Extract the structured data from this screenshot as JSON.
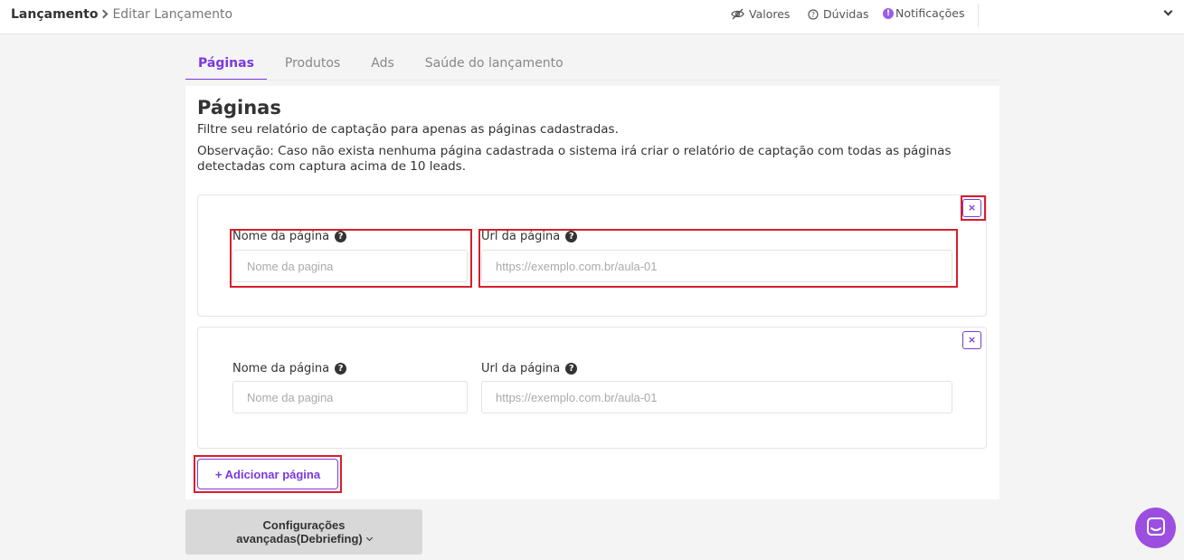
{
  "header": {
    "breadcrumb_current": "Lançamento",
    "breadcrumb_page": "Editar Lançamento",
    "nav": {
      "valores": "Valores",
      "duvidas": "Dúvidas",
      "notificacoes": "Notificações",
      "notif_badge": "!"
    }
  },
  "tabs": [
    {
      "label": "Páginas",
      "active": true
    },
    {
      "label": "Produtos",
      "active": false
    },
    {
      "label": "Ads",
      "active": false
    },
    {
      "label": "Saúde do lançamento",
      "active": false
    }
  ],
  "section": {
    "title": "Páginas",
    "description": "Filtre seu relatório de captação para apenas as páginas cadastradas.",
    "note": "Observação: Caso não exista nenhuma página cadastrada o sistema irá criar o relatório de captação com todas as páginas detectadas com captura acima de 10 leads."
  },
  "pages": [
    {
      "close_label": "×",
      "name_label": "Nome da página",
      "name_placeholder": "Nome da pagina",
      "name_value": "",
      "url_label": "Url da página",
      "url_placeholder": "https://exemplo.com.br/aula-01",
      "url_value": ""
    },
    {
      "close_label": "×",
      "name_label": "Nome da página",
      "name_placeholder": "Nome da pagina",
      "name_value": "",
      "url_label": "Url da página",
      "url_placeholder": "https://exemplo.com.br/aula-01",
      "url_value": ""
    }
  ],
  "help_glyph": "?",
  "add_page_button": "+ Adicionar página",
  "advanced_button": {
    "line1": "Configurações",
    "line2": "avançadas(Debriefing)"
  },
  "icons": [
    "eye-slash-icon",
    "question-circle-icon",
    "notification-icon",
    "chevron-down-icon",
    "help-icon",
    "close-icon",
    "chat-icon"
  ],
  "colors": {
    "accent": "#7a39e0",
    "highlight": "#d71f2a",
    "chat_fab": "#9b4ee0",
    "advanced_bg": "#d8d8d8"
  }
}
